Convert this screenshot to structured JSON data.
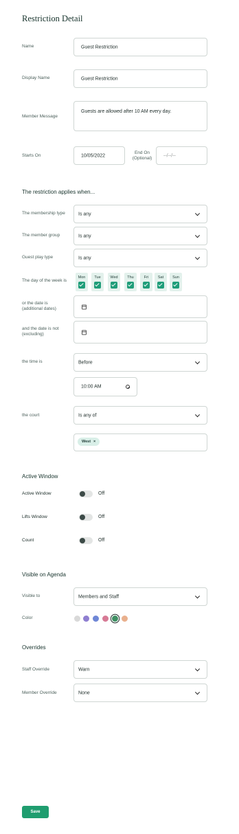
{
  "page": {
    "title": "Restriction Detail"
  },
  "details": {
    "name_label": "Name",
    "name_value": "Guest Restriction",
    "display_name_label": "Display Name",
    "display_name_value": "Guest Restriction",
    "member_message_label": "Member Message",
    "member_message_value": "Guests are allowed after 10 AM every day.",
    "starts_on_label": "Starts On",
    "starts_on_value": "10/05/2022",
    "ends_on_label_1": "End On",
    "ends_on_label_2": "(Optional)",
    "ends_on_placeholder": "--/--/--"
  },
  "applies": {
    "heading": "The restriction applies when...",
    "membership_type_label": "The membership type",
    "membership_type_value": "Is any",
    "member_group_label": "The member group",
    "member_group_value": "Is any",
    "guest_play_type_label": "Guest play type",
    "guest_play_type_value": "Is any",
    "day_of_week_label": "The day of the week is",
    "days": [
      "Mon",
      "Tue",
      "Wed",
      "Thu",
      "Fri",
      "Sat",
      "Sun"
    ],
    "days_checked": [
      true,
      true,
      true,
      true,
      true,
      true,
      true
    ],
    "date_is_label_1": "or the date is",
    "date_is_label_2": "(additional dates)",
    "date_not_label_1": "and the date is not",
    "date_not_label_2": "(excluding)",
    "time_label": "the time is",
    "time_condition": "Before",
    "time_value": "10:00 AM",
    "court_label": "the court",
    "court_condition": "Is any of",
    "court_chips": [
      "West"
    ]
  },
  "active_window": {
    "heading": "Active Window",
    "toggles": [
      {
        "label": "Active Window",
        "state": "Off",
        "on": false
      },
      {
        "label": "Lifts Window",
        "state": "Off",
        "on": false
      },
      {
        "label": "Count",
        "state": "Off",
        "on": false
      }
    ]
  },
  "agenda": {
    "heading": "Visible on Agenda",
    "visible_to_label": "Visible to",
    "visible_to_value": "Members and Staff",
    "color_label": "Color",
    "colors": [
      "#d9d9d9",
      "#8f7fd1",
      "#6f87d6",
      "#d77a95",
      "#3f8f63",
      "#e9b08d"
    ],
    "selected_color_index": 4
  },
  "overrides": {
    "heading": "Overrides",
    "staff_override_label": "Staff Override",
    "staff_override_value": "Warn",
    "member_override_label": "Member Override",
    "member_override_value": "None"
  },
  "actions": {
    "save_label": "Save"
  }
}
